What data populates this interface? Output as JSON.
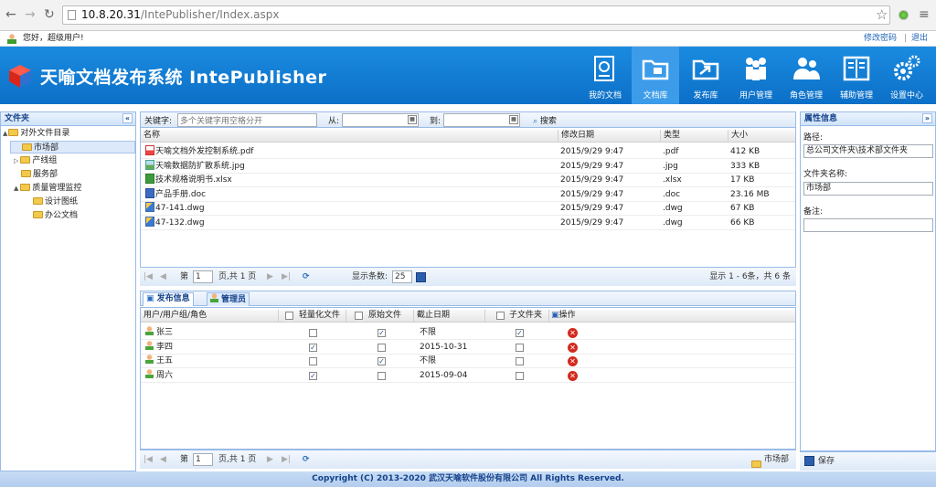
{
  "browser": {
    "url_domain": "10.8.20.31",
    "url_path": "/IntePublisher/Index.aspx"
  },
  "userbar": {
    "greeting": "您好，超级用户!",
    "change_password": "修改密码",
    "separator": "|",
    "logout": "退出"
  },
  "header": {
    "title": "天喻文档发布系统 IntePublisher",
    "nav": [
      {
        "label": "我的文档",
        "icon": "document-icon"
      },
      {
        "label": "文档库",
        "icon": "folder-library-icon"
      },
      {
        "label": "发布库",
        "icon": "publish-icon"
      },
      {
        "label": "用户管理",
        "icon": "users-icon"
      },
      {
        "label": "角色管理",
        "icon": "roles-icon"
      },
      {
        "label": "辅助管理",
        "icon": "book-icon"
      },
      {
        "label": "设置中心",
        "icon": "gears-icon"
      }
    ],
    "active_nav": "文档库"
  },
  "left": {
    "title": "文件夹",
    "tree": [
      {
        "label": "对外文件目录",
        "level": 0,
        "expander": "▲"
      },
      {
        "label": "市场部",
        "level": 1,
        "expander": "",
        "selected": true
      },
      {
        "label": "产线组",
        "level": 1,
        "expander": "▷"
      },
      {
        "label": "服务部",
        "level": 1,
        "expander": ""
      },
      {
        "label": "质量管理监控",
        "level": 1,
        "expander": "▲"
      },
      {
        "label": "设计图纸",
        "level": 2,
        "expander": ""
      },
      {
        "label": "办公文档",
        "level": 2,
        "expander": ""
      }
    ]
  },
  "search": {
    "keyword_label": "关键字:",
    "keyword_placeholder": "多个关键字用空格分开",
    "from_label": "从:",
    "to_label": "到:",
    "search_button": "搜索"
  },
  "files": {
    "columns": [
      "名称",
      "修改日期",
      "类型",
      "大小"
    ],
    "rows": [
      {
        "name": "天喻文档外发控制系统.pdf",
        "date": "2015/9/29 9:47",
        "type": ".pdf",
        "size": "412 KB",
        "icon": "pdf-icon"
      },
      {
        "name": "天喻数据防扩散系统.jpg",
        "date": "2015/9/29 9:47",
        "type": ".jpg",
        "size": "333 KB",
        "icon": "image-icon"
      },
      {
        "name": "技术规格说明书.xlsx",
        "date": "2015/9/29 9:47",
        "type": ".xlsx",
        "size": "17 KB",
        "icon": "excel-icon"
      },
      {
        "name": "产品手册.doc",
        "date": "2015/9/29 9:47",
        "type": ".doc",
        "size": "23.16 MB",
        "icon": "word-icon"
      },
      {
        "name": "47-141.dwg",
        "date": "2015/9/29 9:47",
        "type": ".dwg",
        "size": "67 KB",
        "icon": "dwg-icon"
      },
      {
        "name": "47-132.dwg",
        "date": "2015/9/29 9:47",
        "type": ".dwg",
        "size": "66 KB",
        "icon": "dwg-icon"
      }
    ]
  },
  "pager1": {
    "page_prefix": "第",
    "page": "1",
    "page_suffix": "页,共 1 页",
    "size_label": "显示条数:",
    "size": "25",
    "summary": "显示 1 - 6条，共 6 条"
  },
  "tabs": [
    {
      "label": "发布信息"
    },
    {
      "label": "管理员"
    }
  ],
  "publish": {
    "columns": [
      "用户/用户组/角色",
      "轻量化文件",
      "原始文件",
      "截止日期",
      "子文件夹",
      "操作"
    ],
    "rows": [
      {
        "user": "张三",
        "light": false,
        "orig": true,
        "deadline": "不限",
        "sub": true
      },
      {
        "user": "李四",
        "light": true,
        "orig": false,
        "deadline": "2015-10-31",
        "sub": false
      },
      {
        "user": "王五",
        "light": false,
        "orig": true,
        "deadline": "不限",
        "sub": false
      },
      {
        "user": "周六",
        "light": true,
        "orig": false,
        "deadline": "2015-09-04",
        "sub": false
      }
    ]
  },
  "pager2": {
    "page_prefix": "第",
    "page": "1",
    "page_suffix": "页,共 1 页",
    "folder": "市场部"
  },
  "right": {
    "title": "属性信息",
    "path_label": "路径:",
    "path_value": "总公司文件夹\\技术部文件夹",
    "name_label": "文件夹名称:",
    "name_value": "市场部",
    "note_label": "备注:",
    "note_value": "",
    "save": "保存"
  },
  "footer": {
    "text": "Copyright (C) 2013-2020 武汉天喻软件股份有限公司 All Rights Reserved."
  }
}
